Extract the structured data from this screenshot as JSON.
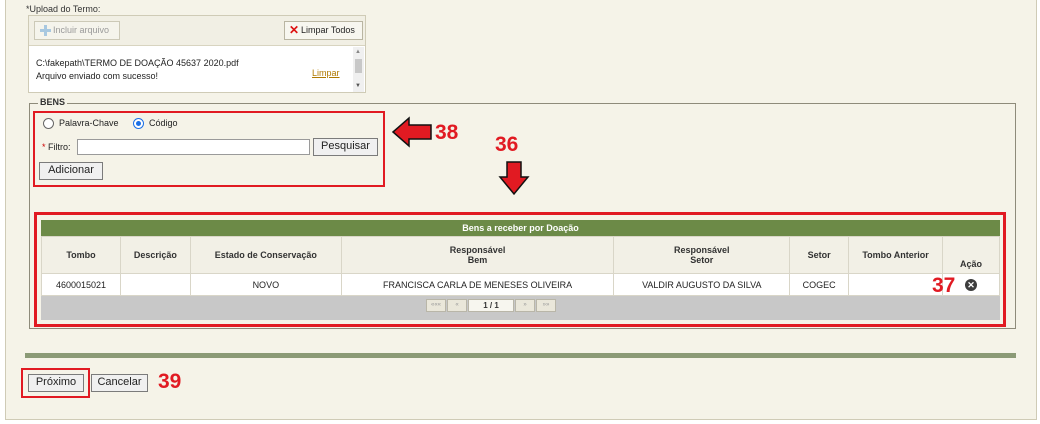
{
  "upload": {
    "label": "*Upload do Termo:",
    "include_button": "Incluir arquivo",
    "clear_all_button": "Limpar Todos",
    "file_path": "C:\\fakepath\\TERMO DE DOAÇÃO 45637 2020.pdf",
    "file_status": "Arquivo enviado com sucesso!",
    "remove_link": "Limpar"
  },
  "bens": {
    "legend": "BENS",
    "radio_keyword": "Palavra-Chave",
    "radio_code": "Código",
    "selected_radio": "Código",
    "filter_required_mark": "*",
    "filter_label": "Filtro:",
    "filter_value": "",
    "search_button": "Pesquisar",
    "add_button": "Adicionar"
  },
  "grid": {
    "caption": "Bens a receber por Doação",
    "columns": {
      "tombo": "Tombo",
      "descricao": "Descrição",
      "estado": "Estado de Conservação",
      "resp_bem_1": "Responsável",
      "resp_bem_2": "Bem",
      "resp_setor_1": "Responsável",
      "resp_setor_2": "Setor",
      "setor": "Setor",
      "tombo_anterior": "Tombo Anterior",
      "acao": "Ação"
    },
    "row": {
      "tombo": "4600015021",
      "descricao": "",
      "estado": "NOVO",
      "responsavel_bem": "FRANCISCA CARLA DE MENESES OLIVEIRA",
      "responsavel_setor": "VALDIR AUGUSTO DA SILVA",
      "setor": "COGEC",
      "tombo_anterior": ""
    },
    "pager": {
      "first": "«««",
      "prev": "«",
      "page": "1 / 1",
      "next": "»",
      "last": "»»"
    }
  },
  "footer": {
    "next_button": "Próximo",
    "cancel_button": "Cancelar"
  },
  "annotations": {
    "c36": "36",
    "c37": "37",
    "c38": "38",
    "c39": "39",
    "color": "#e11a22"
  }
}
